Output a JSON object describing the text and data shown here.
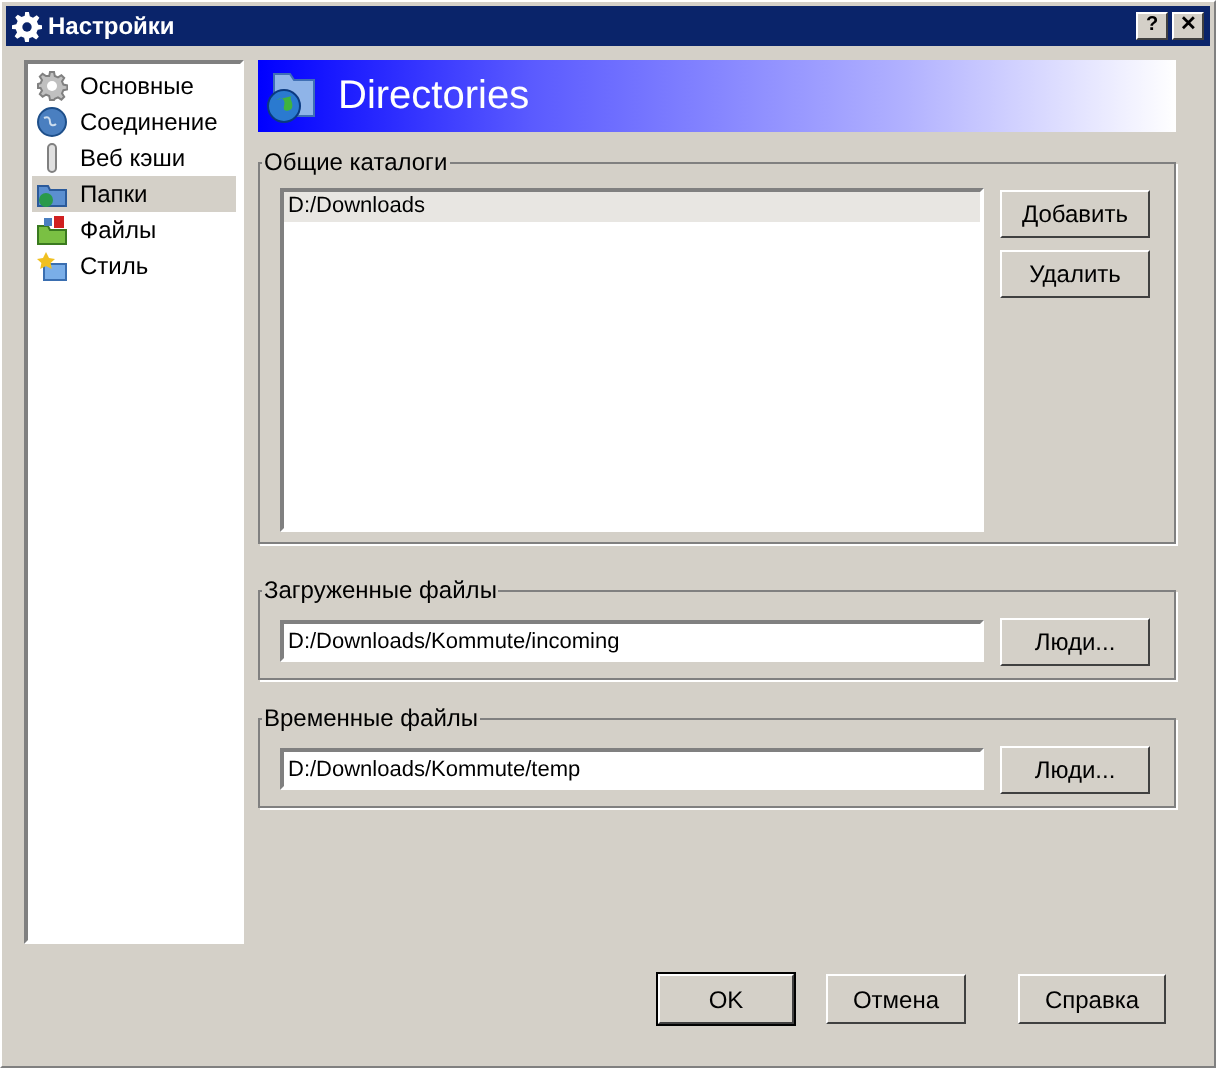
{
  "window": {
    "title": "Настройки",
    "controls": [
      "?",
      "✕"
    ]
  },
  "sidebar": {
    "items": [
      {
        "label": "Основные",
        "selected": false
      },
      {
        "label": "Соединение",
        "selected": false
      },
      {
        "label": "Веб кэши",
        "selected": false
      },
      {
        "label": "Папки",
        "selected": true
      },
      {
        "label": "Файлы",
        "selected": false
      },
      {
        "label": "Стиль",
        "selected": false
      }
    ]
  },
  "header": {
    "title": "Directories"
  },
  "shared_dirs": {
    "title": "Общие каталоги",
    "items": [
      {
        "label": "D:/Downloads",
        "selected": true
      }
    ],
    "buttons": [
      "Добавить",
      "Удалить"
    ]
  },
  "download_dir": {
    "title": "Загруженные файлы",
    "value": "D:/Downloads/Kommute/incoming",
    "button": "Люди..."
  },
  "temp_dir": {
    "title": "Временные файлы",
    "value": "D:/Downloads/Kommute/temp",
    "button": "Люди..."
  },
  "buttons": [
    "OK",
    "Отмена",
    "Справка"
  ]
}
